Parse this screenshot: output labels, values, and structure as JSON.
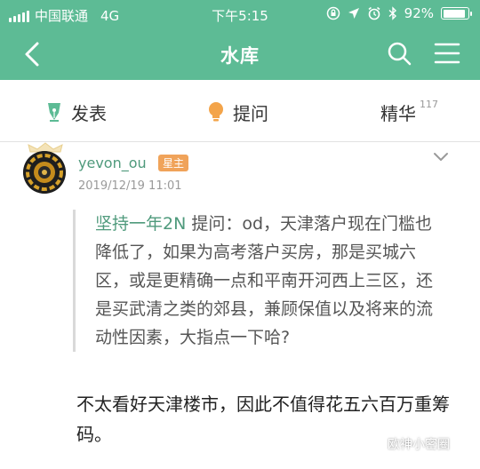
{
  "status_bar": {
    "carrier": "中国联通",
    "network": "4G",
    "time": "下午5:15",
    "battery": "92%",
    "battery_level": 0.92,
    "icons": [
      "lock-rotation-icon",
      "location-icon",
      "alarm-icon",
      "bluetooth-icon",
      "battery-icon"
    ]
  },
  "nav": {
    "title": "水库",
    "icons": [
      "back-icon",
      "search-icon",
      "menu-icon"
    ]
  },
  "tabs": [
    {
      "label": "发表",
      "icon": "pen-nib-icon"
    },
    {
      "label": "提问",
      "icon": "lightbulb-icon"
    },
    {
      "label": "精华",
      "count": "117"
    }
  ],
  "post": {
    "username": "yevon_ou",
    "badge": "星主",
    "date": "2019/12/19 11:01",
    "question": {
      "asker": "坚持一年2N",
      "prefix": "提问：",
      "text": "od，天津落户现在门槛也降低了，如果为高考落户买房，那是买城六区，或是更精确一点和平南开河西上三区，还是买武清之类的郊县，兼顾保值以及将来的流动性因素，大指点一下哈?"
    },
    "answer": "不太看好天津楼市，因此不值得花五六百万重筹码。"
  },
  "watermark": "欧神小密圈",
  "colors": {
    "accent": "#5dbb95",
    "link_green": "#4f9a7c",
    "badge_orange": "#f0a35a"
  }
}
